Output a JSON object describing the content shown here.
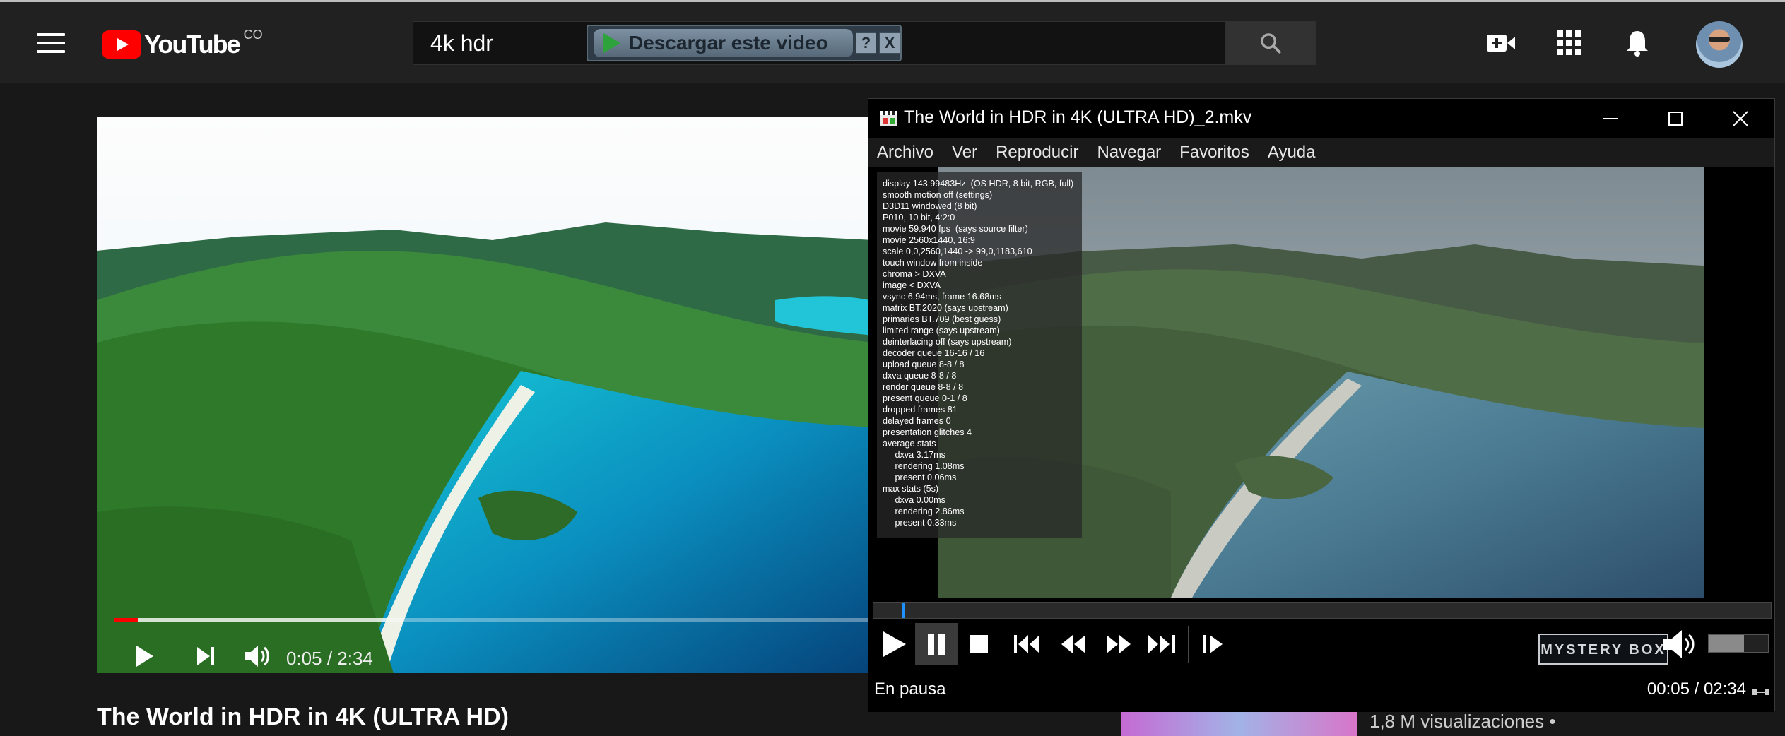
{
  "youtube": {
    "logo_text": "YouTube",
    "country": "CO",
    "search": {
      "value": "4k hdr"
    },
    "download_popup": {
      "label": "Descargar este video",
      "help": "?",
      "close": "X"
    },
    "player": {
      "time": "0:05 / 2:34",
      "progress": 0.032,
      "buffered": 0.36
    },
    "video_title": "The World in HDR in 4K (ULTRA HD)",
    "recommendation": {
      "views": "1,8 M visualizaciones •"
    }
  },
  "mpc": {
    "title": "The World in HDR in 4K (ULTRA HD)_2.mkv",
    "menu": [
      "Archivo",
      "Ver",
      "Reproducir",
      "Navegar",
      "Favoritos",
      "Ayuda"
    ],
    "stats": [
      "display 143.99483Hz  (OS HDR, 8 bit, RGB, full)",
      "smooth motion off (settings)",
      "D3D11 windowed (8 bit)",
      "P010, 10 bit, 4:2:0",
      "movie 59.940 fps  (says source filter)",
      "movie 2560x1440, 16:9",
      "scale 0,0,2560,1440 -> 99,0,1183,610",
      "touch window from inside",
      "chroma > DXVA",
      "image < DXVA",
      "vsync 6.94ms, frame 16.68ms",
      "matrix BT.2020 (says upstream)",
      "primaries BT.709 (best guess)",
      "limited range (says upstream)",
      "deinterlacing off (says upstream)",
      "decoder queue 16-16 / 16",
      "upload queue 8-8 / 8",
      "dxva queue 8-8 / 8",
      "render queue 8-8 / 8",
      "present queue 0-1 / 8",
      "dropped frames 81",
      "delayed frames 0",
      "presentation glitches 4",
      "average stats",
      "     dxva 3.17ms",
      "     rendering 1.08ms",
      "     present 0.06ms",
      "max stats (5s)",
      "     dxva 0.00ms",
      "     rendering 2.86ms",
      "     present 0.33ms"
    ],
    "watermark": "MYSTERY BOX",
    "status": "En pausa",
    "time": "00:05 / 02:34",
    "seek_progress": 0.032,
    "volume": 0.6
  }
}
